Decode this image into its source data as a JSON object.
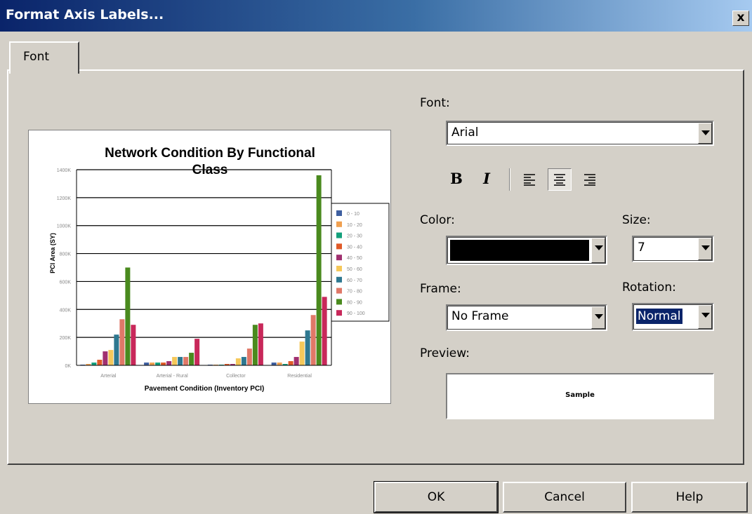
{
  "window": {
    "title": "Format Axis Labels...",
    "close_glyph": "x"
  },
  "tabs": [
    {
      "label": "Font"
    }
  ],
  "font": {
    "label": "Font:",
    "value": "Arial"
  },
  "format_buttons": {
    "bold": "B",
    "italic": "I"
  },
  "color": {
    "label": "Color:",
    "value": "#000000"
  },
  "size": {
    "label": "Size:",
    "value": "7"
  },
  "frame": {
    "label": "Frame:",
    "value": "No Frame"
  },
  "rotation": {
    "label": "Rotation:",
    "value": "Normal"
  },
  "preview": {
    "label": "Preview:",
    "sample": "Sample"
  },
  "buttons": {
    "ok": "OK",
    "cancel": "Cancel",
    "help": "Help"
  },
  "chart_data": {
    "type": "bar",
    "title": "Network Condition By Functional Class",
    "xlabel": "Pavement Condition (Inventory PCI)",
    "ylabel": "PCI Area (SY)",
    "ylim": [
      0,
      1400000
    ],
    "yticks": [
      "0K",
      "200K",
      "400K",
      "600K",
      "800K",
      "1000K",
      "1200K",
      "1400K"
    ],
    "categories": [
      "Arterial",
      "Arterial - Rural",
      "Collector",
      "Residential"
    ],
    "legend_position": "right",
    "grid": true,
    "series": [
      {
        "name": "0 - 10",
        "color": "#3e5fa0",
        "values": [
          5000,
          20000,
          5000,
          20000
        ]
      },
      {
        "name": "10 - 20",
        "color": "#f0a050",
        "values": [
          10000,
          20000,
          5000,
          20000
        ]
      },
      {
        "name": "20 - 30",
        "color": "#14a07c",
        "values": [
          20000,
          20000,
          5000,
          10000
        ]
      },
      {
        "name": "30 - 40",
        "color": "#e05a28",
        "values": [
          40000,
          20000,
          10000,
          30000
        ]
      },
      {
        "name": "40 - 50",
        "color": "#a03070",
        "values": [
          100000,
          30000,
          10000,
          60000
        ]
      },
      {
        "name": "50 - 60",
        "color": "#f5c85a",
        "values": [
          110000,
          60000,
          50000,
          170000
        ]
      },
      {
        "name": "60 - 70",
        "color": "#2e7890",
        "values": [
          220000,
          60000,
          60000,
          250000
        ]
      },
      {
        "name": "70 - 80",
        "color": "#e07868",
        "values": [
          330000,
          60000,
          120000,
          360000
        ]
      },
      {
        "name": "80 - 90",
        "color": "#4a8a1e",
        "values": [
          700000,
          90000,
          290000,
          1360000
        ]
      },
      {
        "name": "90 - 100",
        "color": "#c8285a",
        "values": [
          290000,
          190000,
          300000,
          490000
        ]
      }
    ]
  }
}
